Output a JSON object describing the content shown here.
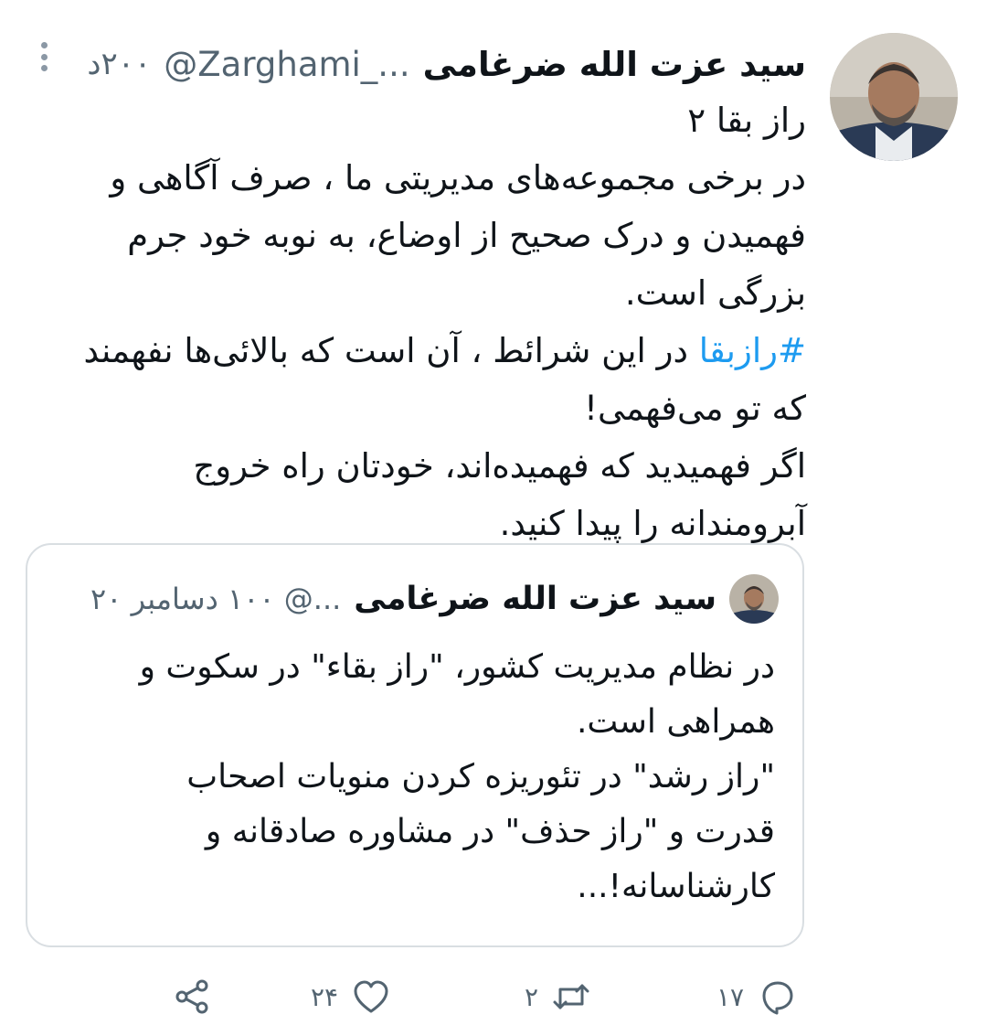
{
  "tweet": {
    "author_name": "سید عزت الله ضرغامی",
    "handle": "@Zarghami_...",
    "time": "۲۰۰د",
    "lines": [
      "راز بقا ۲",
      " در برخی مجموعه‌های مدیریتی ما ، صرف آگاهی و",
      "فهمیدن و درک صحیح از اوضاع،  به نوبه خود جرم",
      "بزرگی است."
    ],
    "hashtag": "#رازبقا",
    "hashtag_rest": " در این شرائط ، آن است که بالائی‌ها نفهمند",
    "lines_after": [
      "که تو می‌فهمی!",
      "اگر فهمیدید که فهمیده‌اند، خودتان راه خروج",
      "آبرومندانه را پیدا کنید."
    ]
  },
  "quoted_tweet": {
    "author_name": "سید عزت الله ضرغامی",
    "meta": "...@ ۱۰۰ دسامبر ۲۰",
    "lines": [
      "در نظام مدیریت کشور، \"راز بقاء\" در سکوت و",
      "همراهی است.",
      "\"راز رشد\" در تئوریزه کردن منویات اصحاب",
      "قدرت و \"راز حذف\" در مشاوره صادقانه و",
      "کارشناسانه!..."
    ]
  },
  "actions": {
    "reply_count": "۱۷",
    "retweet_count": "۲",
    "like_count": "۲۴",
    "share_count": ""
  },
  "colors": {
    "text": "#0f1419",
    "secondary": "#536471",
    "link": "#1d9bf0",
    "border": "#d9dee2"
  },
  "icons": [
    "more-options-icon",
    "reply-icon",
    "retweet-icon",
    "like-icon",
    "share-icon"
  ]
}
